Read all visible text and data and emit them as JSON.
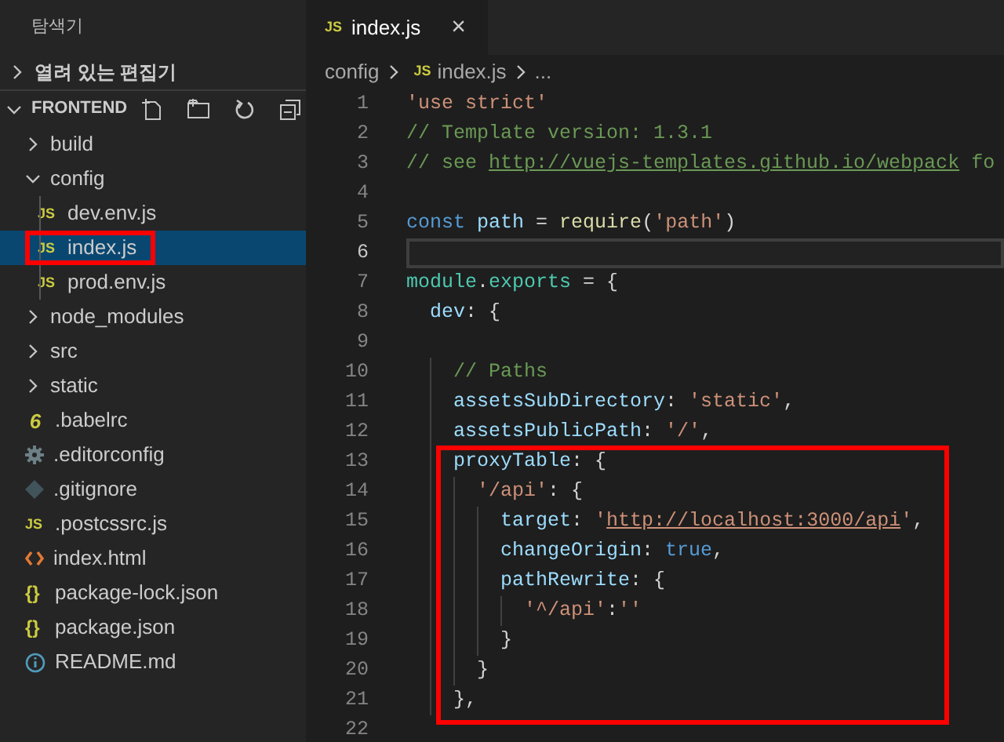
{
  "sidebar": {
    "title": "탐색기",
    "open_editors": {
      "label": "열려 있는 편집기",
      "expanded": false
    },
    "project": {
      "label": "FRONTEND",
      "expanded": true
    },
    "tree": [
      {
        "kind": "folder",
        "label": "build",
        "expanded": false,
        "selected": false,
        "boxed": false
      },
      {
        "kind": "folder",
        "label": "config",
        "expanded": true,
        "selected": false,
        "boxed": false,
        "children": [
          {
            "kind": "js",
            "badge": "JS",
            "label": "dev.env.js",
            "selected": false,
            "boxed": false
          },
          {
            "kind": "js",
            "badge": "JS",
            "label": "index.js",
            "selected": true,
            "boxed": true
          },
          {
            "kind": "js",
            "badge": "JS",
            "label": "prod.env.js",
            "selected": false,
            "boxed": false
          }
        ]
      },
      {
        "kind": "folder",
        "label": "node_modules",
        "expanded": false,
        "selected": false,
        "boxed": false
      },
      {
        "kind": "folder",
        "label": "src",
        "expanded": false,
        "selected": false,
        "boxed": false
      },
      {
        "kind": "folder",
        "label": "static",
        "expanded": false,
        "selected": false,
        "boxed": false
      },
      {
        "kind": "babel",
        "badge": "6",
        "label": ".babelrc",
        "selected": false,
        "boxed": false
      },
      {
        "kind": "config",
        "label": ".editorconfig",
        "selected": false,
        "boxed": false
      },
      {
        "kind": "git",
        "label": ".gitignore",
        "selected": false,
        "boxed": false
      },
      {
        "kind": "js",
        "badge": "JS",
        "label": ".postcssrc.js",
        "selected": false,
        "boxed": false
      },
      {
        "kind": "html",
        "label": "index.html",
        "selected": false,
        "boxed": false
      },
      {
        "kind": "json",
        "badge": "{}",
        "label": "package-lock.json",
        "selected": false,
        "boxed": false
      },
      {
        "kind": "json",
        "badge": "{}",
        "label": "package.json",
        "selected": false,
        "boxed": false
      },
      {
        "kind": "info",
        "label": "README.md",
        "selected": false,
        "boxed": false
      }
    ]
  },
  "tabs": [
    {
      "badge": "JS",
      "label": "index.js",
      "close": "×",
      "selected": true
    }
  ],
  "breadcrumb": {
    "folder": "config",
    "badge": "JS",
    "file": "index.js",
    "more": "..."
  },
  "editor": {
    "blocks": [
      {
        "kind": "plain",
        "lines": [
          {
            "number": "1",
            "current": false,
            "tokens": [
              {
                "kind": "string",
                "text": "'use strict'"
              }
            ]
          },
          {
            "number": "2",
            "current": false,
            "tokens": [
              {
                "kind": "comment",
                "text": "// Template version: 1.3.1"
              }
            ]
          },
          {
            "number": "3",
            "current": false,
            "tokens": [
              {
                "kind": "comment",
                "text": "// see "
              },
              {
                "kind": "comment-link",
                "text": "http://vuejs-templates.github.io/webpack"
              },
              {
                "kind": "comment",
                "text": " fo"
              }
            ]
          },
          {
            "number": "4",
            "current": false
          },
          {
            "number": "5",
            "current": false,
            "tokens": [
              {
                "kind": "keyword",
                "text": "const"
              },
              {
                "kind": "variable",
                "text": " path"
              },
              {
                "kind": "plain",
                "text": " = "
              },
              {
                "kind": "function",
                "text": "require"
              },
              {
                "kind": "plain",
                "text": "("
              },
              {
                "kind": "string",
                "text": "'path'"
              },
              {
                "kind": "plain",
                "text": ")"
              }
            ]
          },
          {
            "number": "6",
            "current": true
          },
          {
            "number": "7",
            "current": false,
            "tokens": [
              {
                "kind": "type",
                "text": "module"
              },
              {
                "kind": "plain",
                "text": "."
              },
              {
                "kind": "type",
                "text": "exports"
              },
              {
                "kind": "plain",
                "text": " = {"
              }
            ]
          },
          {
            "number": "8",
            "current": false,
            "tokens": [
              {
                "kind": "property",
                "text": "  dev"
              },
              {
                "kind": "plain",
                "text": ": {"
              }
            ]
          },
          {
            "number": "9",
            "current": false
          },
          {
            "number": "10",
            "current": false,
            "tokens": [
              {
                "kind": "comment",
                "text": "    // Paths"
              }
            ]
          },
          {
            "number": "11",
            "current": false,
            "tokens": [
              {
                "kind": "property",
                "text": "    assetsSubDirectory"
              },
              {
                "kind": "plain",
                "text": ": "
              },
              {
                "kind": "string",
                "text": "'static'"
              },
              {
                "kind": "plain",
                "text": ","
              }
            ]
          },
          {
            "number": "12",
            "current": false,
            "tokens": [
              {
                "kind": "property",
                "text": "    assetsPublicPath"
              },
              {
                "kind": "plain",
                "text": ": "
              },
              {
                "kind": "string",
                "text": "'/'"
              },
              {
                "kind": "plain",
                "text": ","
              }
            ]
          }
        ]
      },
      {
        "kind": "highlighted",
        "lines": [
          {
            "number": "13",
            "current": false,
            "tokens": [
              {
                "kind": "property",
                "text": "    proxyTable"
              },
              {
                "kind": "plain",
                "text": ": {"
              }
            ]
          },
          {
            "number": "14",
            "current": false,
            "tokens": [
              {
                "kind": "string",
                "text": "      '/api'"
              },
              {
                "kind": "plain",
                "text": ": {"
              }
            ]
          },
          {
            "number": "15",
            "current": false,
            "tokens": [
              {
                "kind": "property",
                "text": "        target"
              },
              {
                "kind": "plain",
                "text": ": "
              },
              {
                "kind": "string",
                "text": "'"
              },
              {
                "kind": "string-link",
                "text": "http://localhost:3000/api"
              },
              {
                "kind": "string",
                "text": "'"
              },
              {
                "kind": "plain",
                "text": ","
              }
            ]
          },
          {
            "number": "16",
            "current": false,
            "tokens": [
              {
                "kind": "property",
                "text": "        changeOrigin"
              },
              {
                "kind": "plain",
                "text": ": "
              },
              {
                "kind": "keyword",
                "text": "true"
              },
              {
                "kind": "plain",
                "text": ","
              }
            ]
          },
          {
            "number": "17",
            "current": false,
            "tokens": [
              {
                "kind": "property",
                "text": "        pathRewrite"
              },
              {
                "kind": "plain",
                "text": ": {"
              }
            ]
          },
          {
            "number": "18",
            "current": false,
            "tokens": [
              {
                "kind": "string",
                "text": "          '^/api'"
              },
              {
                "kind": "plain",
                "text": ":"
              },
              {
                "kind": "string",
                "text": "''"
              }
            ]
          },
          {
            "number": "19",
            "current": false,
            "tokens": [
              {
                "kind": "plain",
                "text": "        }"
              }
            ]
          },
          {
            "number": "20",
            "current": false,
            "tokens": [
              {
                "kind": "plain",
                "text": "      }"
              }
            ]
          },
          {
            "number": "21",
            "current": false,
            "tokens": [
              {
                "kind": "plain",
                "text": "    },"
              }
            ]
          }
        ]
      },
      {
        "kind": "plain",
        "lines": [
          {
            "number": "22",
            "current": false
          }
        ]
      }
    ]
  }
}
